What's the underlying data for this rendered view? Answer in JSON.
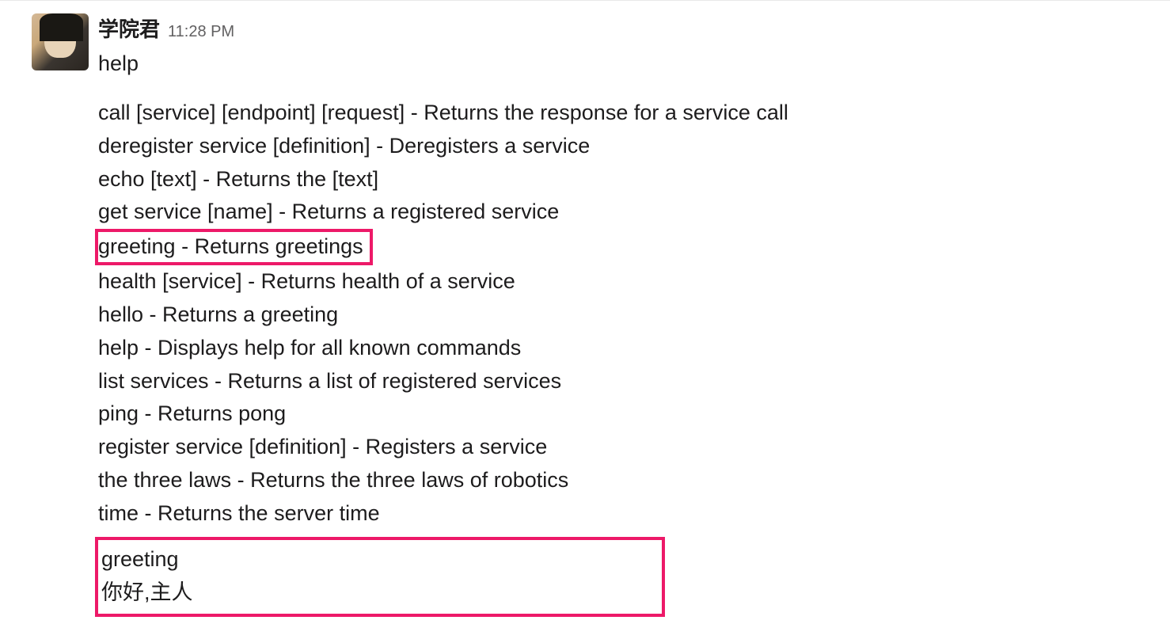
{
  "message": {
    "username": "学院君",
    "timestamp": "11:28 PM",
    "first_line": "help",
    "help_lines": [
      "call [service] [endpoint] [request] - Returns the response for a service call",
      "deregister service [definition] - Deregisters a service",
      "echo [text] - Returns the [text]",
      "get service [name] - Returns a registered service"
    ],
    "highlighted_help_line": "greeting - Returns greetings",
    "help_lines_after": [
      "health [service] - Returns health of a service",
      "hello - Returns a greeting",
      "help - Displays help for all known commands",
      "list services - Returns a list of registered services",
      "ping - Returns pong",
      "register service [definition] - Registers a service",
      "the three laws - Returns the three laws of robotics",
      "time - Returns the server time"
    ],
    "highlighted_box": {
      "line1": "greeting",
      "line2": "你好,主人"
    }
  }
}
